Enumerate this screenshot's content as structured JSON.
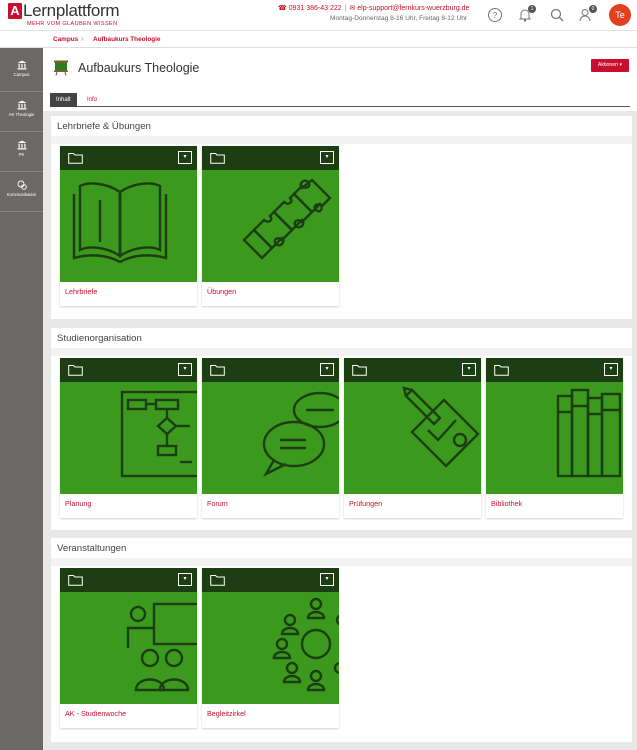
{
  "header": {
    "logo_letter": "A",
    "logo_word": "Lernplattform",
    "logo_tagline": "MEHR VOM GLAUBEN WISSEN",
    "phone": "0931 386-43 222",
    "email": "elp-support@fernkurs-wuerzburg.de",
    "hours": "Montag-Donnerstag 8-16 Uhr, Freitag 8-12 Uhr",
    "notifications_count": "1",
    "contacts_count": "0",
    "avatar_initials": "Te",
    "accent_color": "#c8102e"
  },
  "breadcrumb": [
    "Campus",
    "Aufbaukurs Theologie"
  ],
  "sidebar": {
    "items": [
      {
        "label": "Campus",
        "icon": "institution-icon"
      },
      {
        "label": "AK Theologie",
        "icon": "institution-icon"
      },
      {
        "label": "PK",
        "icon": "institution-icon"
      },
      {
        "label": "Kommunikation",
        "icon": "chat-icon"
      }
    ]
  },
  "page": {
    "title": "Aufbaukurs Theologie",
    "actions_label": "Aktionen",
    "tabs": [
      {
        "label": "Inhalt",
        "active": true
      },
      {
        "label": "Info",
        "active": false
      }
    ]
  },
  "sections": [
    {
      "title": "Lehrbriefe & Übungen",
      "tiles": [
        {
          "label": "Lehrbriefe",
          "icon": "book-icon"
        },
        {
          "label": "Übungen",
          "icon": "puzzle-icon"
        }
      ]
    },
    {
      "title": "Studienorganisation",
      "tiles": [
        {
          "label": "Planung",
          "icon": "flowchart-icon"
        },
        {
          "label": "Forum",
          "icon": "speech-bubbles-icon"
        },
        {
          "label": "Prüfungen",
          "icon": "exam-pencil-icon"
        },
        {
          "label": "Bibliothek",
          "icon": "books-icon"
        }
      ]
    },
    {
      "title": "Veranstaltungen",
      "tiles": [
        {
          "label": "AK - Studienwoche",
          "icon": "presentation-icon"
        },
        {
          "label": "Begleitzirkel",
          "icon": "circle-group-icon"
        }
      ]
    }
  ],
  "colors": {
    "tile_green": "#3b9a1e",
    "tile_header": "#1d3e12",
    "sidebar": "#6b6866"
  }
}
